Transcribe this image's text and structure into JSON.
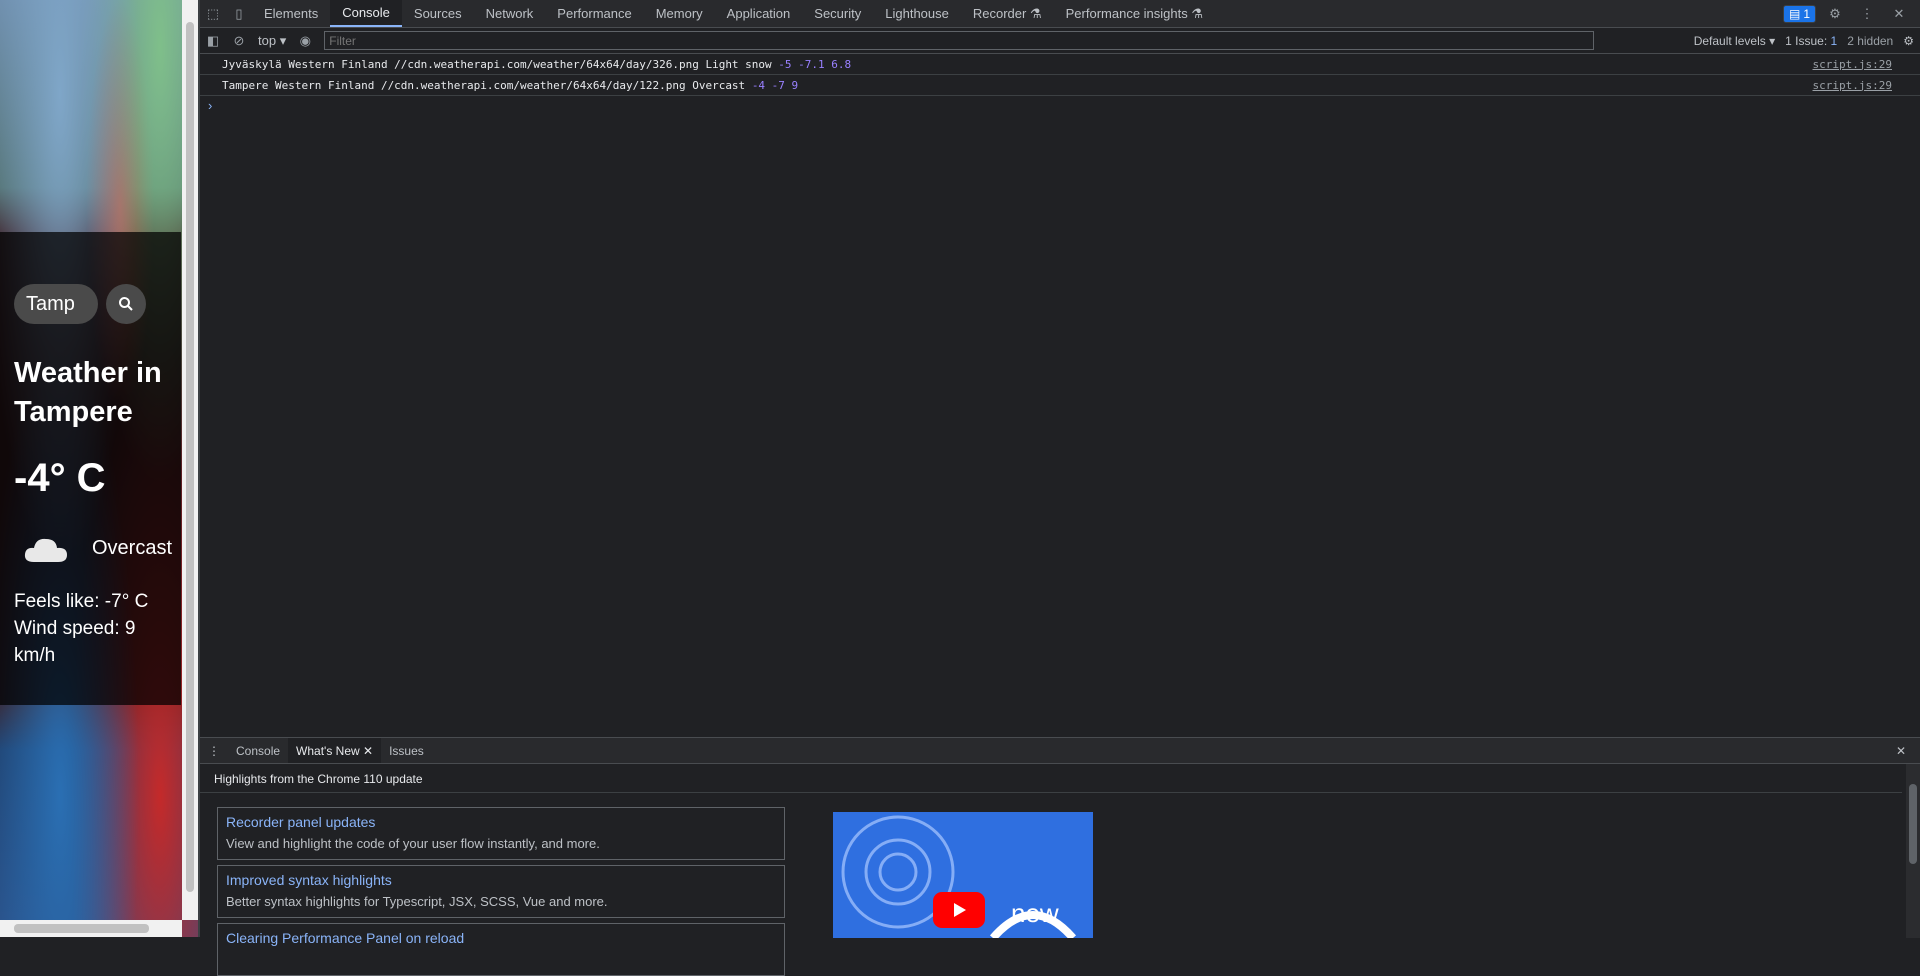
{
  "weather_app": {
    "search_value": "Tamp",
    "title": "Weather in Tampere",
    "temperature": "-4° C",
    "condition": "Overcast",
    "feels_like": "Feels like: -7° C",
    "wind": "Wind speed: 9 km/h"
  },
  "devtools": {
    "tabs": [
      "Elements",
      "Console",
      "Sources",
      "Network",
      "Performance",
      "Memory",
      "Application",
      "Security",
      "Lighthouse",
      "Recorder",
      "Performance insights"
    ],
    "active_tab": "Console",
    "issues_badge": "1",
    "context": "top",
    "filter_placeholder": "Filter",
    "default_levels": "Default levels",
    "issues_label": "1 Issue:",
    "issues_count": "1",
    "hidden": "2 hidden",
    "messages": [
      {
        "text": "Jyväskylä Western Finland //cdn.weatherapi.com/weather/64x64/day/326.png Light snow ",
        "nums": "-5 -7.1 6.8",
        "source": "script.js:29"
      },
      {
        "text": "Tampere Western Finland //cdn.weatherapi.com/weather/64x64/day/122.png Overcast ",
        "nums": "-4 -7 9",
        "source": "script.js:29"
      }
    ],
    "drawer": {
      "tabs": [
        "Console",
        "What's New",
        "Issues"
      ],
      "active_tab": "What's New",
      "heading": "Highlights from the Chrome 110 update",
      "cards": [
        {
          "title": "Recorder panel updates",
          "desc": "View and highlight the code of your user flow instantly, and more."
        },
        {
          "title": "Improved syntax highlights",
          "desc": "Better syntax highlights for Typescript, JSX, SCSS, Vue and more."
        },
        {
          "title": "Clearing Performance Panel on reload",
          "desc": ""
        }
      ],
      "video_label": "new"
    }
  }
}
